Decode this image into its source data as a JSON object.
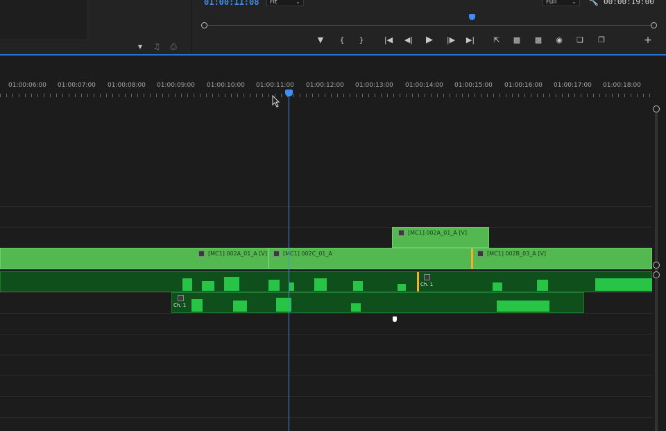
{
  "monitor": {
    "timecode": "01:00:11:08",
    "fit_option": "Fit",
    "resolution_option": "Full",
    "duration": "00:00:19:00"
  },
  "ruler": {
    "labels": [
      "01:00:06:00",
      "01:00:07:00",
      "01:00:08:00",
      "01:00:09:00",
      "01:00:10:00",
      "01:00:11:00",
      "01:00:12:00",
      "01:00:13:00",
      "01:00:14:00",
      "01:00:15:00",
      "01:00:16:00",
      "01:00:17:00",
      "01:00:18:00"
    ]
  },
  "clips": {
    "v2_clip": "[MC1] 002A_01_A [V]",
    "v1_clip_a": "[MC1] 002A_01_A [V]",
    "v1_clip_b": "[MC1] 002C_01_A",
    "v1_clip_c": "[MC1] 002B_03_A [V]",
    "a1_channel": "Ch. 1",
    "a2_channel": "Ch. 1"
  },
  "icons": {
    "monitor": [
      "add-marker-icon",
      "mark-in-icon",
      "mark-out-icon",
      "go-to-in-icon",
      "step-back-icon",
      "play-icon",
      "step-forward-icon",
      "go-to-out-icon",
      "lift-icon",
      "extract-icon",
      "insert-icon",
      "export-frame-icon",
      "compare-icon",
      "overlay-icon",
      "add-button-icon"
    ],
    "project": [
      "filter-icon",
      "automate-icon",
      "new-bin-icon"
    ]
  },
  "colors": {
    "accent": "#3d8ff0",
    "video_clip": "#52b84f",
    "audio_clip": "#0e4f1c",
    "waveform": "#28c446",
    "edit_point": "#f0b030"
  }
}
